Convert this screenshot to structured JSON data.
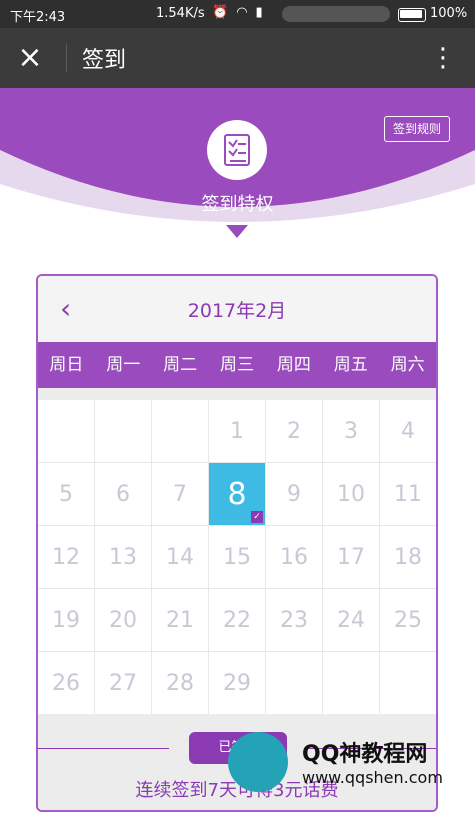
{
  "status_bar": {
    "time": "下午2:43",
    "network_speed": "1.54K/s",
    "battery_percent": "100%",
    "icons": [
      "alarm-icon",
      "wifi-icon",
      "signal-icon",
      "battery-icon"
    ]
  },
  "header": {
    "close_icon": "close-icon",
    "title": "签到",
    "menu_icon": "more-vertical-icon"
  },
  "banner": {
    "rules_label": "签到规则",
    "badge_icon": "checklist-icon",
    "privilege_label": "签到特权",
    "accent_color": "#9a4bbd"
  },
  "calendar": {
    "prev_icon": "chevron-left-icon",
    "month_label": "2017年2月",
    "weekdays": [
      "周日",
      "周一",
      "周二",
      "周三",
      "周四",
      "周五",
      "周六"
    ],
    "today": "8",
    "highlight_color": "#3dbbe4",
    "rows": [
      [
        "",
        "",
        "",
        "1",
        "2",
        "3",
        "4"
      ],
      [
        "5",
        "6",
        "7",
        "8",
        "9",
        "10",
        "11"
      ],
      [
        "12",
        "13",
        "14",
        "15",
        "16",
        "17",
        "18"
      ],
      [
        "19",
        "20",
        "21",
        "22",
        "23",
        "24",
        "25"
      ],
      [
        "26",
        "27",
        "28",
        "29",
        "",
        "",
        ""
      ]
    ]
  },
  "footer": {
    "signed_button": "已签到",
    "streak_text": "连续签到7天可得3元话费"
  },
  "watermark": {
    "title": "QQ神教程网",
    "url": "www.qqshen.com"
  }
}
